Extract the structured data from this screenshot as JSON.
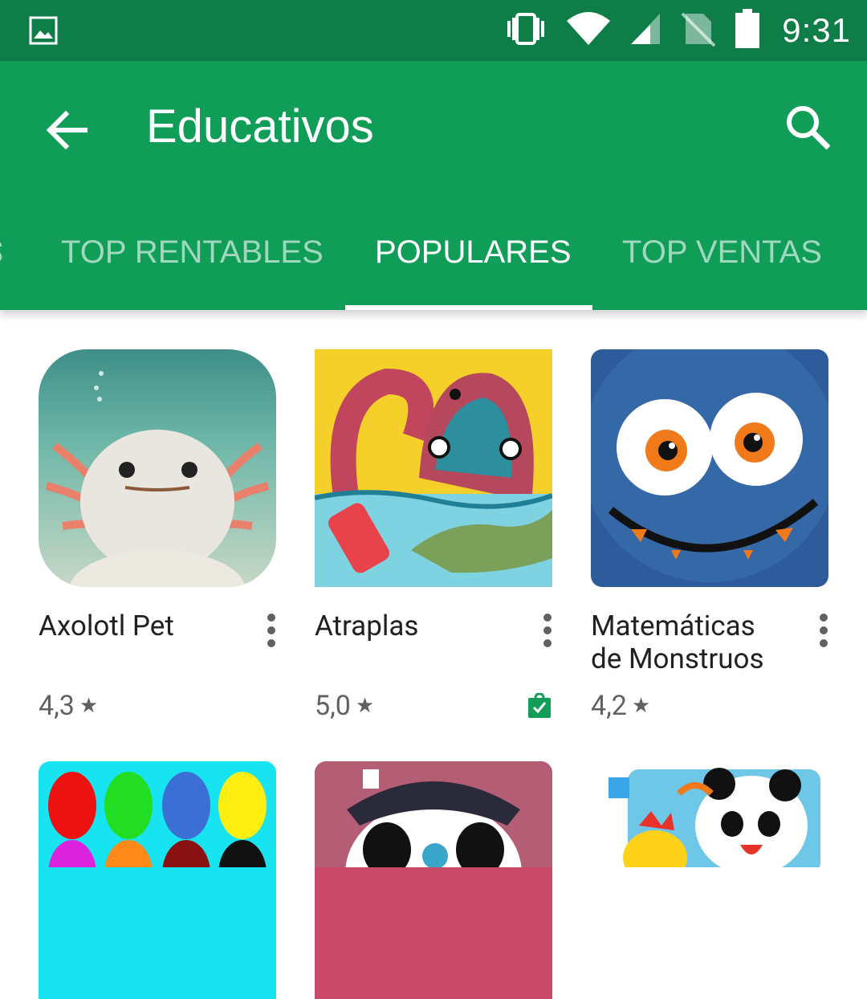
{
  "status_bar": {
    "time": "9:31",
    "icons": [
      "image-icon",
      "vibrate-icon",
      "wifi-icon",
      "signal-icon",
      "no-sim-icon",
      "battery-icon"
    ]
  },
  "app_bar": {
    "title": "Educativos",
    "back_icon": "arrow-back-icon",
    "search_icon": "search-icon",
    "background": "#0f9d58"
  },
  "tabs": [
    {
      "label": "TOP RENTABLES",
      "active": false
    },
    {
      "label": "POPULARES",
      "active": true
    },
    {
      "label": "TOP VENTAS",
      "active": false
    }
  ],
  "apps": [
    {
      "name": "Axolotl Pet",
      "rating": "4,3",
      "installed": false
    },
    {
      "name": "Atraplas",
      "rating": "5,0",
      "installed": true
    },
    {
      "name": "Matemáticas de Monstruos",
      "rating": "4,2",
      "installed": false
    },
    {
      "name": "",
      "rating": "",
      "installed": false
    },
    {
      "name": "",
      "rating": "",
      "installed": false
    },
    {
      "name": "",
      "rating": "",
      "installed": false
    }
  ],
  "star_glyph": "★"
}
